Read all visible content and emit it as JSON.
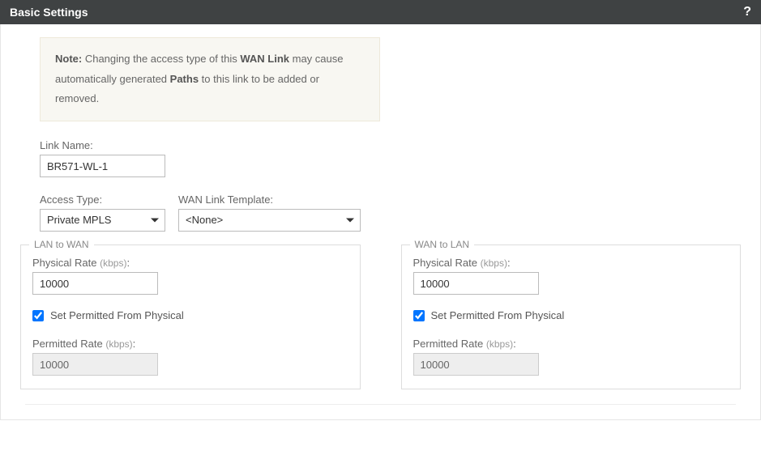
{
  "header": {
    "title": "Basic Settings",
    "help": "?"
  },
  "note": {
    "lead": "Note:",
    "part1": " Changing the access type of this ",
    "wan_link": "WAN Link",
    "part2": " may cause automatically generated ",
    "paths": "Paths",
    "part3": " to this link to be added or removed."
  },
  "fields": {
    "link_name_label": "Link Name:",
    "link_name_value": "BR571-WL-1",
    "access_type_label": "Access Type:",
    "access_type_value": "Private MPLS",
    "wan_template_label": "WAN Link Template:",
    "wan_template_value": "<None>"
  },
  "lan_to_wan": {
    "legend": "LAN to WAN",
    "physical_rate_label": "Physical Rate ",
    "kbps": "(kbps)",
    "colon": ":",
    "physical_rate_value": "10000",
    "set_permitted_label": "Set Permitted From Physical",
    "set_permitted_checked": true,
    "permitted_rate_label": "Permitted Rate ",
    "permitted_rate_value": "10000"
  },
  "wan_to_lan": {
    "legend": "WAN to LAN",
    "physical_rate_label": "Physical Rate ",
    "kbps": "(kbps)",
    "colon": ":",
    "physical_rate_value": "10000",
    "set_permitted_label": "Set Permitted From Physical",
    "set_permitted_checked": true,
    "permitted_rate_label": "Permitted Rate ",
    "permitted_rate_value": "10000"
  }
}
